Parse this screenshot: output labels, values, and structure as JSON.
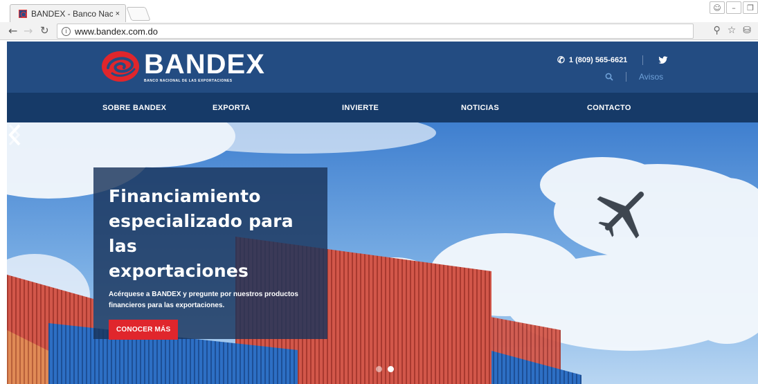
{
  "browser": {
    "tab_title": "BANDEX - Banco Nacion",
    "tab_close": "×",
    "url": "www.bandex.com.do",
    "info_glyph": "i"
  },
  "header": {
    "logo_name": "BANDEX",
    "logo_subtitle": "BANCO NACIONAL DE LAS EXPORTACIONES",
    "phone": "1 (809) 565-6621",
    "avisos": "Avisos"
  },
  "nav": {
    "items": [
      "SOBRE BANDEX",
      "EXPORTA",
      "INVIERTE",
      "NOTICIAS",
      "CONTACTO"
    ]
  },
  "hero": {
    "title_line1": "Financiamiento",
    "title_line2": "especializado para las",
    "title_line3": "exportaciones",
    "subtitle": "Acérquese a BANDEX y pregunte por nuestros productos financieros para las exportaciones.",
    "cta_label": "CONOCER MÁS",
    "slides_count": 2,
    "active_slide": 2
  },
  "colors": {
    "header_bg": "#234c82",
    "nav_bg": "#163a68",
    "accent_red": "#e0262c",
    "link_blue": "#6fa1d8"
  },
  "icons": [
    "info-icon",
    "phone-icon",
    "twitter-icon",
    "search-icon",
    "chevron-left-icon",
    "chevron-right-icon",
    "star-icon",
    "zoom-icon"
  ]
}
